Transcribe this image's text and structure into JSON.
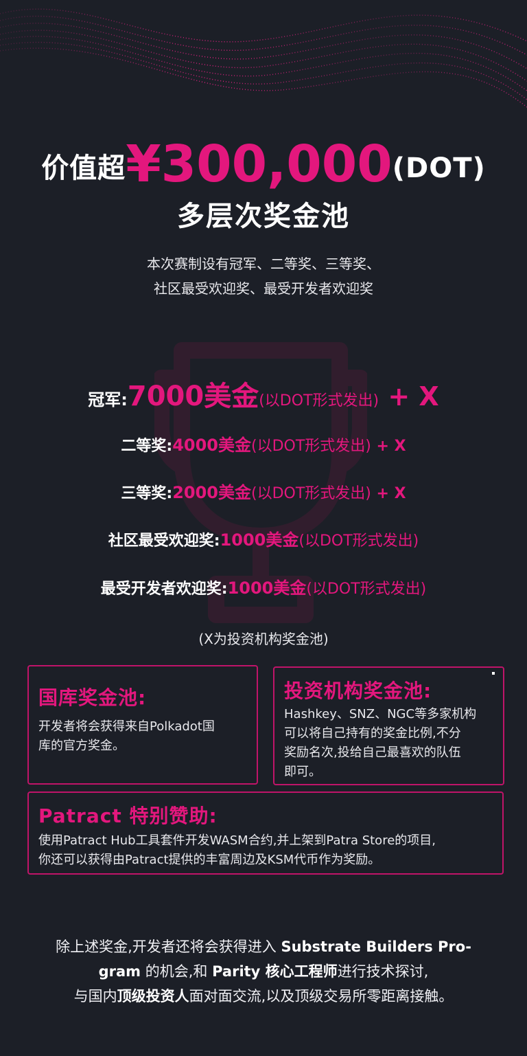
{
  "headline": {
    "prefix": "价值超",
    "amount": "¥300,000",
    "unit": "(DOT)",
    "sub": "多层次奖金池"
  },
  "intro": {
    "line1": "本次赛制设有冠军、二等奖、三等奖、",
    "line2": "社区最受欢迎奖、最受开发者欢迎奖"
  },
  "prizes": [
    {
      "label": "冠军:",
      "amount": "7000美金",
      "note": "(以DOT形式发出)",
      "extra": " + X"
    },
    {
      "label": "二等奖:",
      "amount": "4000美金",
      "note": "(以DOT形式发出)",
      "extra": " + X"
    },
    {
      "label": "三等奖:",
      "amount": "2000美金",
      "note": "(以DOT形式发出)",
      "extra": " + X"
    },
    {
      "label": "社区最受欢迎奖:",
      "amount": "1000美金",
      "note": "(以DOT形式发出)"
    },
    {
      "label": "最受开发者欢迎奖:",
      "amount": "1000美金",
      "note": "(以DOT形式发出)"
    }
  ],
  "x_note": "(X为投资机构奖金池)",
  "boxes": {
    "treasury": {
      "title": "国库奖金池:",
      "line1": "开发者将会获得来自Polkadot国",
      "line2": "库的官方奖金。"
    },
    "investors": {
      "title": "投资机构奖金池:",
      "line1": "Hashkey、SNZ、NGC等多家机构",
      "line2": "可以将自己持有的奖金比例,不分",
      "line3": "奖励名次,投给自己最喜欢的队伍",
      "line4": "即可。"
    },
    "patract": {
      "title": "Patract 特别赞助:",
      "line1": "使用Patract Hub工具套件开发WASM合约,并上架到Patra Store的项目,",
      "line2": "你还可以获得由Patract提供的丰富周边及KSM代币作为奖励。"
    }
  },
  "footer": {
    "l1a": "除上述奖金,开发者还将会获得进入 ",
    "l1b": "Substrate Builders Pro-",
    "l2a": "gram",
    "l2b": " 的机会,和 ",
    "l2c": "Parity 核心工程师",
    "l2d": "进行技术探讨,",
    "l3a": "与国内",
    "l3b": "顶级投资人",
    "l3c": "面对面交流,以及顶级交易所零距离接触。"
  },
  "colors": {
    "background": "#1c1f27",
    "accent": "#e3177d",
    "border": "#c01469"
  },
  "icons": [
    "wave-decoration",
    "trophy-icon"
  ]
}
